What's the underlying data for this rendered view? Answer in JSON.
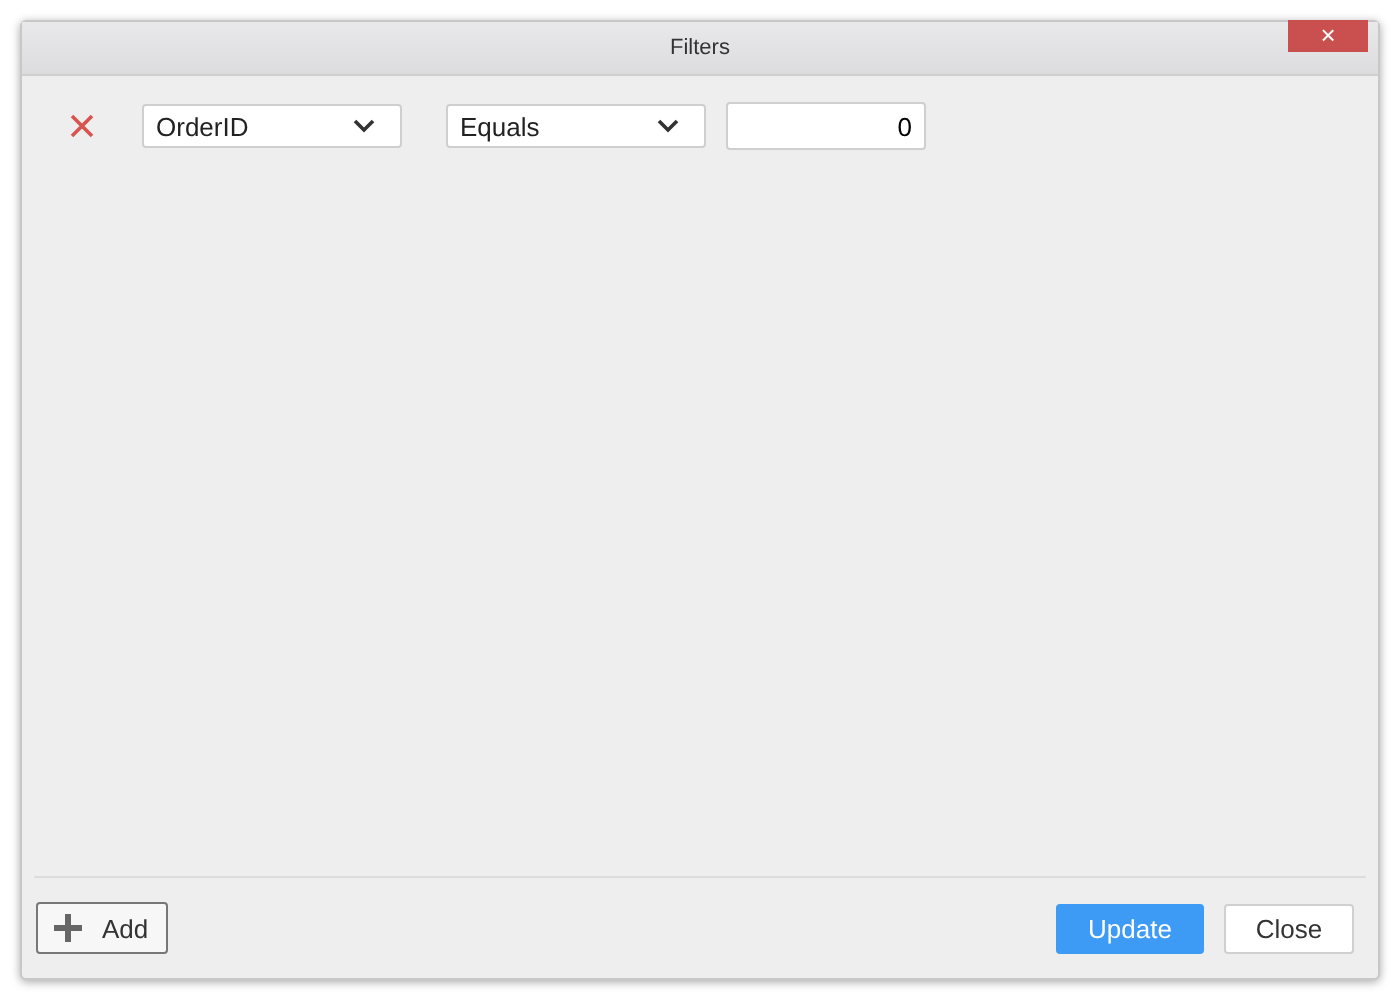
{
  "window": {
    "title": "Filters",
    "close_glyph": "×"
  },
  "filters": [
    {
      "field": "OrderID",
      "operator": "Equals",
      "value": "0"
    }
  ],
  "footer": {
    "add_button": "Add",
    "buttons": [
      {
        "label": "Update",
        "kind": "primary"
      },
      {
        "label": "Close",
        "kind": "default"
      }
    ]
  }
}
